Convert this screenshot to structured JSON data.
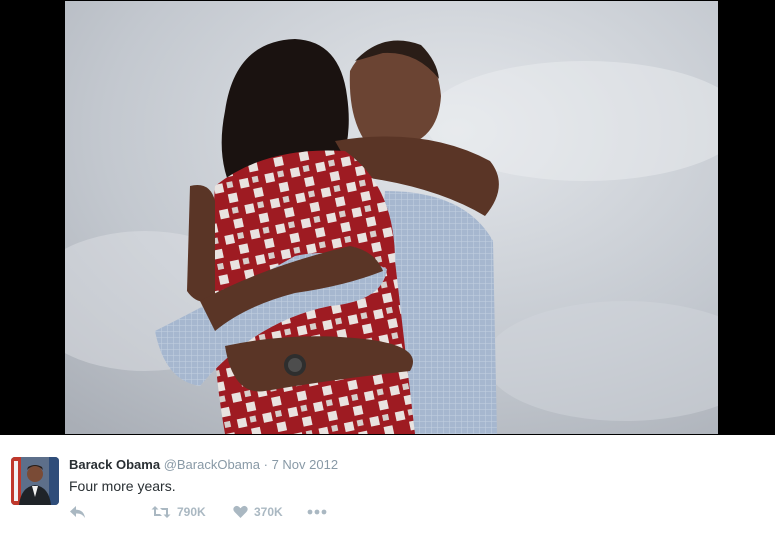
{
  "tweet": {
    "fullname": "Barack Obama",
    "username": "@BarackObama",
    "separator": "·",
    "timestamp": "7 Nov 2012",
    "text": "Four more years."
  },
  "actions": {
    "reply_icon": "reply-icon",
    "retweet_icon": "retweet-icon",
    "retweet_count": "790K",
    "like_icon": "heart-icon",
    "like_count": "370K",
    "more_icon": "more-dots-icon"
  },
  "colors": {
    "frame": "#000000",
    "text": "#292f33",
    "muted": "#8899a6",
    "action": "#aab8c2"
  }
}
